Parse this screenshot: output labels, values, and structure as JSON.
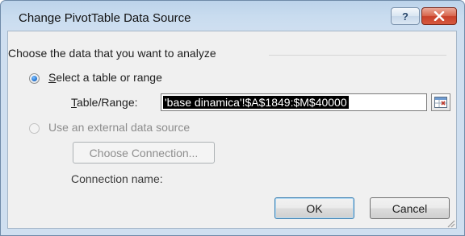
{
  "window": {
    "title": "Change PivotTable Data Source",
    "help_label": "?",
    "help_icon": "question-mark-icon",
    "close_icon": "close-x-icon"
  },
  "group": {
    "label": "Choose the data that you want to analyze"
  },
  "options": {
    "select_range": {
      "label": "Select a table or range",
      "selected": true,
      "enabled": true
    },
    "external_source": {
      "label": "Use an external data source",
      "selected": false,
      "enabled": false
    }
  },
  "range": {
    "label": "Table/Range:",
    "value": "'base dinamica'!$A$1849:$M$40000",
    "collapse_icon": "range-selector-icon"
  },
  "connection": {
    "choose_button": "Choose Connection...",
    "name_label": "Connection name:",
    "name_value": ""
  },
  "buttons": {
    "ok": "OK",
    "cancel": "Cancel"
  },
  "colors": {
    "title_bar": "#c9dcef",
    "client": "#f0f0f0",
    "close_button": "#c8402a",
    "radio_dot": "#2a78d2",
    "selection": "#000000"
  }
}
